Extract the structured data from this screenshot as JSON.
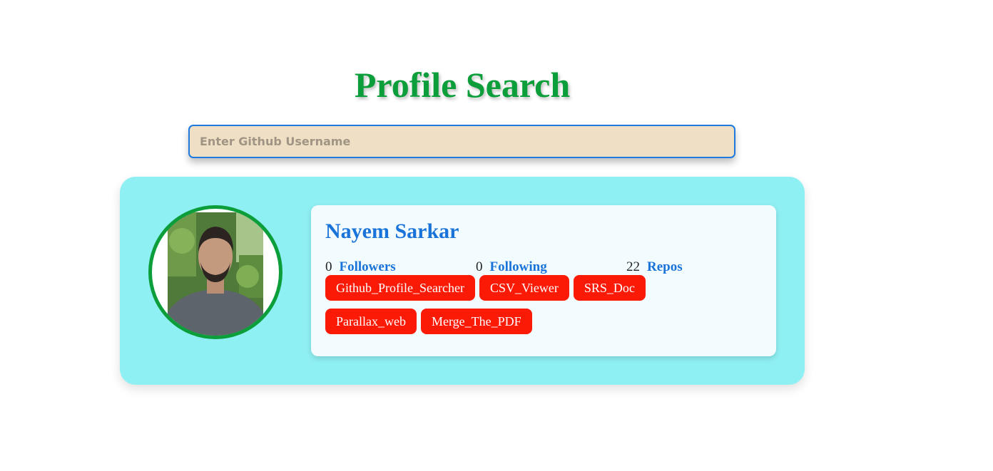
{
  "header": {
    "title": "Profile Search"
  },
  "search": {
    "placeholder": "Enter Github Username",
    "value": ""
  },
  "profile": {
    "name": "Nayem Sarkar",
    "followers": {
      "count": "0",
      "label": "Followers"
    },
    "following": {
      "count": "0",
      "label": "Following"
    },
    "repos": {
      "count": "22",
      "label": "Repos"
    },
    "repo_list": [
      "Github_Profile_Searcher",
      "CSV_Viewer",
      "SRS_Doc",
      "Parallax_web",
      "Merge_The_PDF"
    ]
  },
  "colors": {
    "title": "#0b9e3a",
    "card_bg": "#8ff0f3",
    "info_bg": "#f2fcfe",
    "accent_blue": "#1a73d9",
    "repo_bg": "#fb1a06",
    "input_bg": "#efdfc4",
    "avatar_border": "#0b9e3a"
  },
  "icons": {
    "avatar": "user-photo"
  }
}
